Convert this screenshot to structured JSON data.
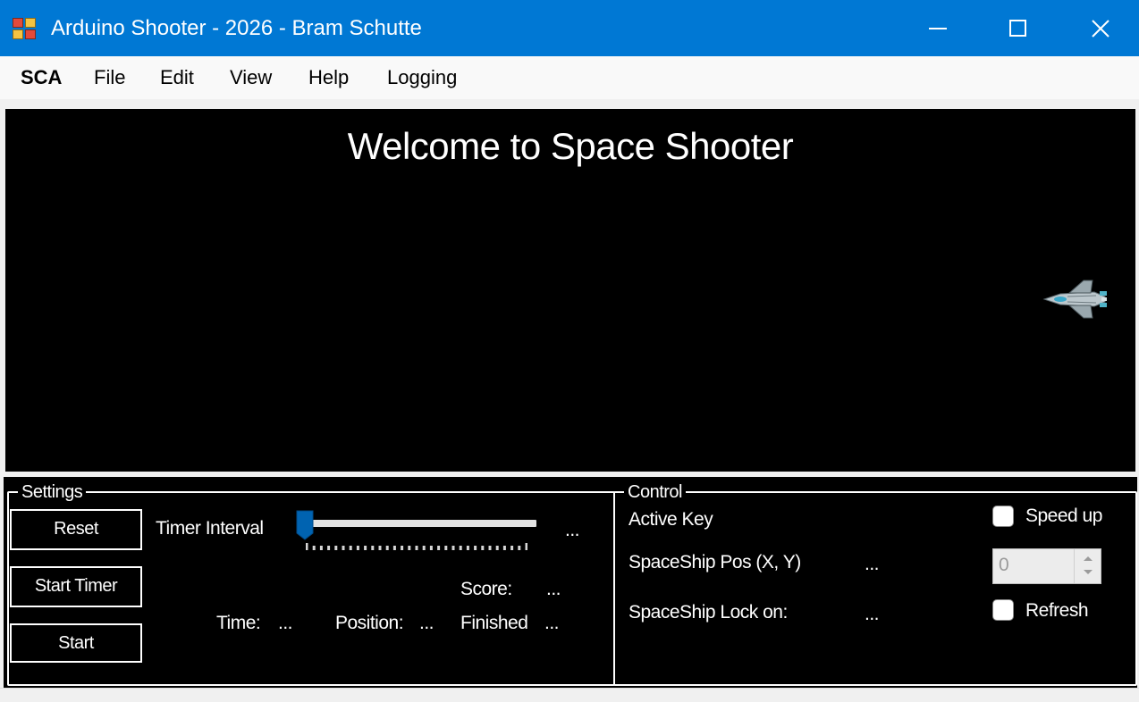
{
  "window": {
    "title": "Arduino Shooter - 2026 - Bram Schutte"
  },
  "menu": {
    "items": [
      {
        "label": "SCA"
      },
      {
        "label": "File"
      },
      {
        "label": "Edit"
      },
      {
        "label": "View"
      },
      {
        "label": "Help"
      },
      {
        "label": "Logging"
      }
    ]
  },
  "game": {
    "welcome_text": "Welcome to Space Shooter",
    "background": "#000000"
  },
  "settings": {
    "group_label": "Settings",
    "reset_label": "Reset",
    "start_timer_label": "Start Timer",
    "start_label": "Start",
    "timer_interval_label": "Timer Interval",
    "timer_interval_value": "...",
    "timer_interval_fraction": 0.0,
    "score_label": "Score:",
    "score_value": "...",
    "time_label": "Time:",
    "time_value": "...",
    "position_label": "Position:",
    "position_value": "...",
    "finished_label": "Finished",
    "finished_value": "..."
  },
  "control": {
    "group_label": "Control",
    "active_key_label": "Active Key",
    "speed_up_label": "Speed up",
    "speed_up_checked": false,
    "ship_pos_label": "SpaceShip Pos (X, Y)",
    "ship_pos_value": "...",
    "numeric_value": "0",
    "ship_lock_label": "SpaceShip Lock on:",
    "ship_lock_value": "...",
    "refresh_label": "Refresh",
    "refresh_checked": false
  },
  "colors": {
    "titlebar": "#0078d4",
    "accent": "#0063b1",
    "panel": "#000000",
    "text_on_panel": "#ffffff"
  },
  "icons": [
    "app-icon",
    "minimize-icon",
    "maximize-icon",
    "close-icon",
    "spaceship-sprite",
    "spin-up-icon",
    "spin-down-icon"
  ]
}
